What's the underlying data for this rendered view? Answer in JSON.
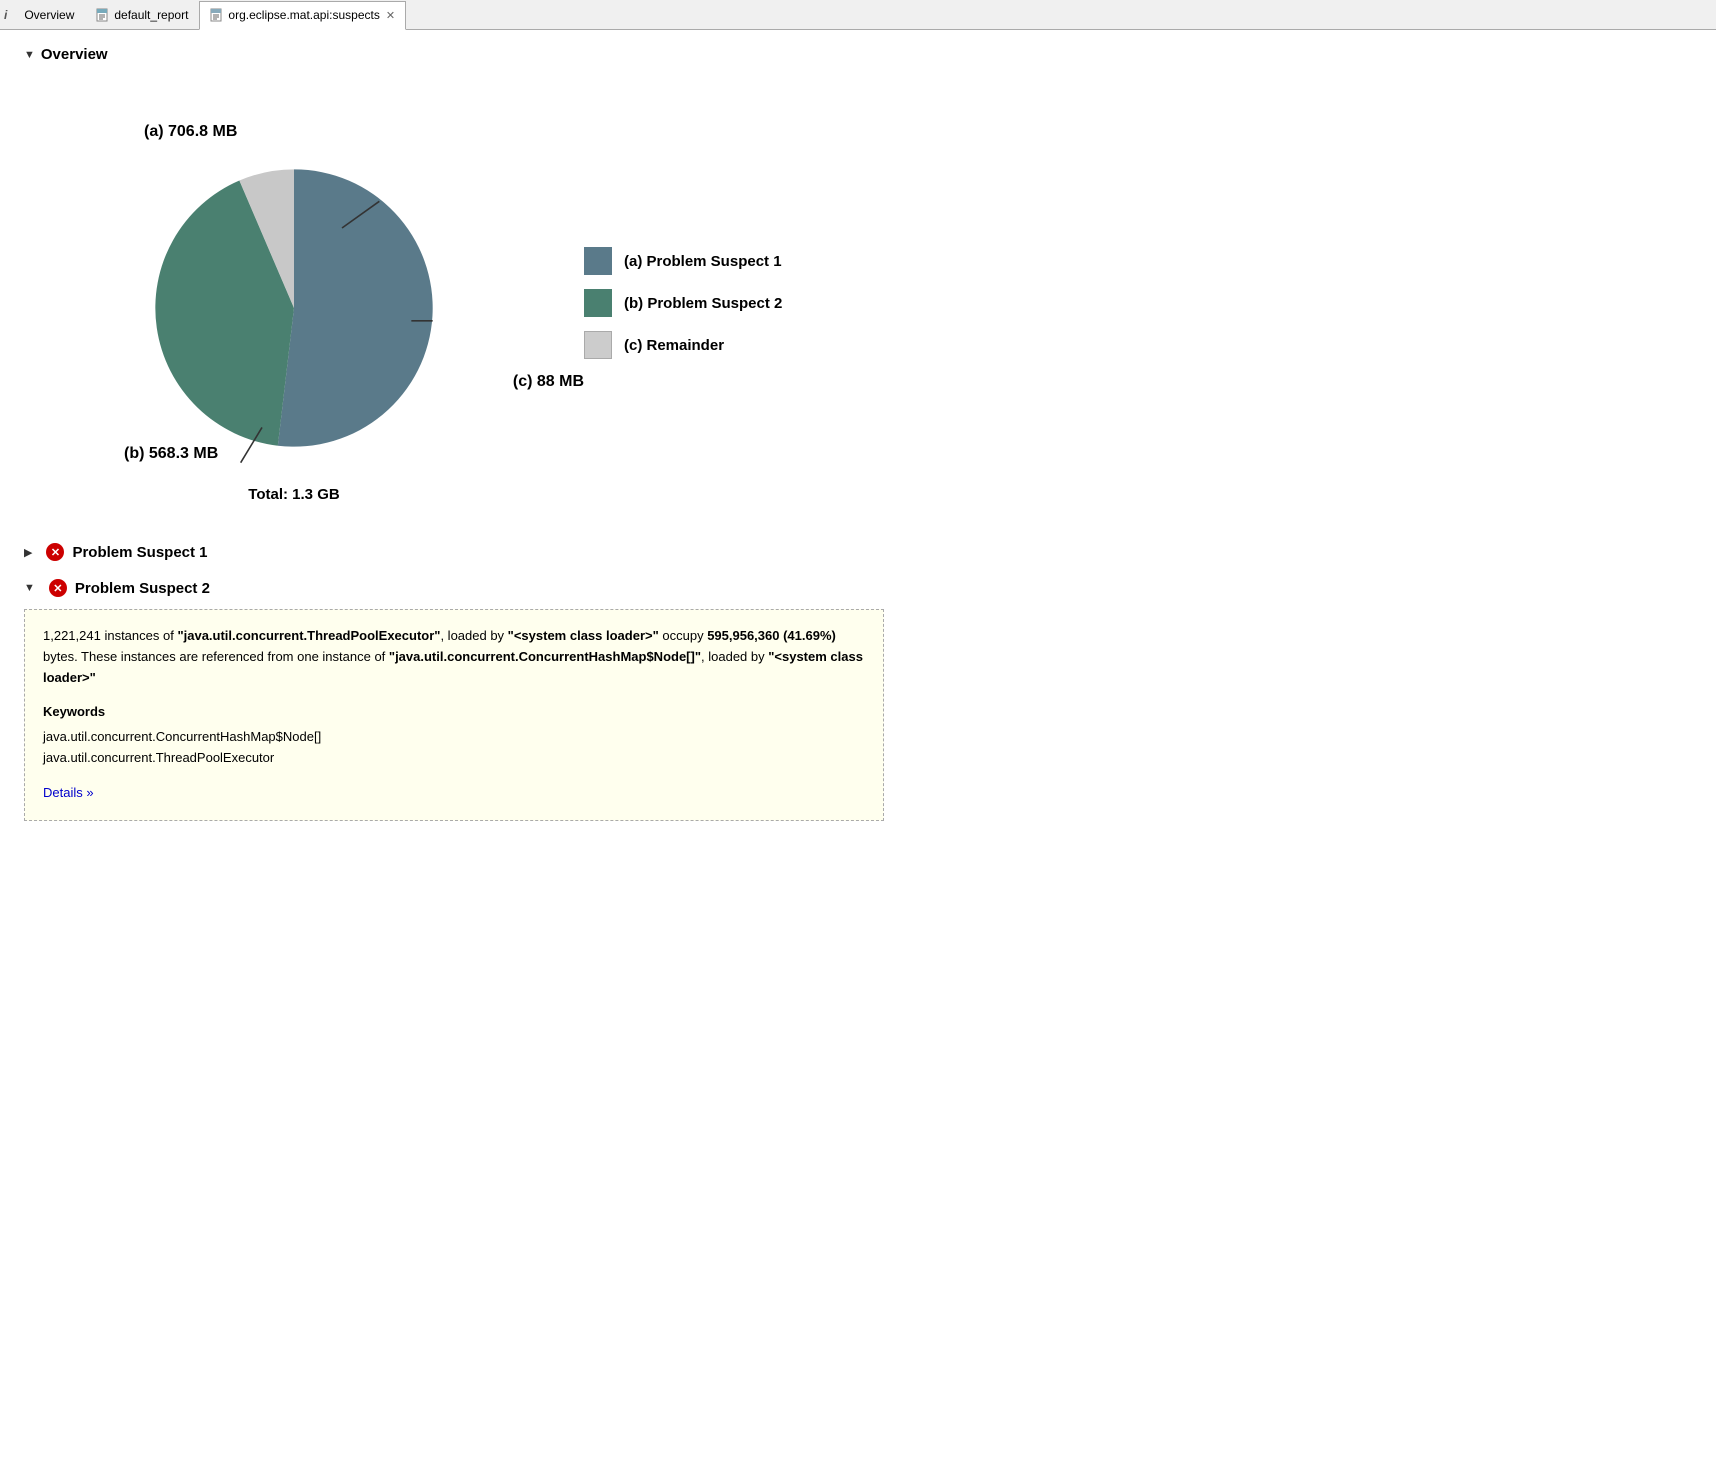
{
  "tabs": {
    "info_icon": "i",
    "overview_tab": {
      "label": "Overview",
      "active": false
    },
    "report_tab": {
      "label": "default_report",
      "active": false
    },
    "suspects_tab": {
      "label": "org.eclipse.mat.api:suspects",
      "active": true,
      "closeable": true
    }
  },
  "overview_section": {
    "title": "Overview",
    "expanded": true,
    "toggle": "▼"
  },
  "pie_chart": {
    "label_a": "(a)  706.8 MB",
    "label_b": "(b)  568.3 MB",
    "label_c": "(c)  88 MB",
    "total": "Total: 1.3 GB",
    "color_a": "#5a7a8a",
    "color_b": "#4a8070",
    "color_c": "#cccccc"
  },
  "legend": {
    "items": [
      {
        "id": "a",
        "label": "(a)  Problem Suspect 1",
        "color": "#5a7a8a"
      },
      {
        "id": "b",
        "label": "(b)  Problem Suspect 2",
        "color": "#4a8070"
      },
      {
        "id": "c",
        "label": "(c)  Remainder",
        "color": "#cccccc"
      }
    ]
  },
  "suspect1": {
    "toggle": "▶",
    "title": "Problem Suspect 1",
    "expanded": false
  },
  "suspect2": {
    "toggle": "▼",
    "title": "Problem Suspect 2",
    "expanded": true,
    "description_parts": {
      "count": "1,221,241",
      "class1": "\"java.util.concurrent.ThreadPoolExecutor\"",
      "loader1": "\"<system class loader>\"",
      "bytes": "595,956,360 (41.69%)",
      "class2": "\"java.util.concurrent.ConcurrentHashMap$Node[]\"",
      "loader2": "\"<system class loader>\""
    },
    "keywords_title": "Keywords",
    "keywords": [
      "java.util.concurrent.ConcurrentHashMap$Node[]",
      "java.util.concurrent.ThreadPoolExecutor"
    ],
    "details_link": "Details »"
  }
}
